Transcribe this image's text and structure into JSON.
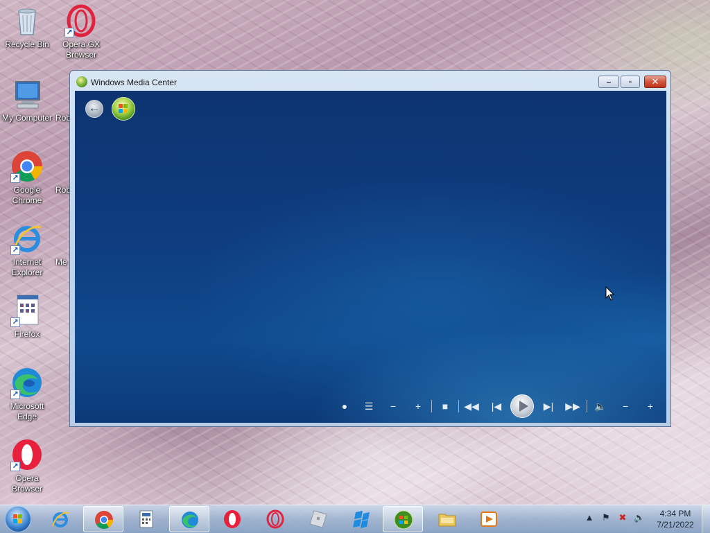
{
  "desktop": {
    "icons": [
      {
        "label": "Recycle Bin",
        "icon": "recycle-bin-icon"
      },
      {
        "label": "Opera GX Browser",
        "icon": "opera-gx-icon"
      },
      {
        "label": "My Computer",
        "icon": "computer-icon"
      },
      {
        "label": "Google Chrome",
        "icon": "chrome-icon"
      },
      {
        "label": "Internet Explorer",
        "icon": "internet-explorer-icon"
      },
      {
        "label": "Firefox",
        "icon": "firefox-icon"
      },
      {
        "label": "Microsoft Edge",
        "icon": "edge-icon"
      },
      {
        "label": "Opera Browser",
        "icon": "opera-icon"
      }
    ],
    "partial_labels": [
      "Rob",
      "Rob",
      "Me"
    ]
  },
  "window": {
    "title": "Windows Media Center",
    "controls": {
      "minimize": "–",
      "restore": "▫",
      "close": "✕"
    },
    "media": {
      "back": "back-icon",
      "start": "windows-start-icon",
      "transport": [
        "record",
        "guide",
        "channel-down",
        "channel-up",
        "stop",
        "rewind",
        "previous",
        "play",
        "next",
        "fast-forward",
        "mute",
        "volume-down",
        "volume-up"
      ]
    }
  },
  "taskbar": {
    "pinned": [
      "start-orb",
      "internet-explorer",
      "chrome",
      "calculator",
      "edge",
      "opera",
      "opera-gx",
      "roblox",
      "roblox-studio",
      "media-center",
      "file-explorer",
      "media-player"
    ],
    "clock_time": "4:34 PM",
    "clock_date": "7/21/2022",
    "colors": {
      "accent": "#0e3d80",
      "close": "#c2341b"
    }
  }
}
